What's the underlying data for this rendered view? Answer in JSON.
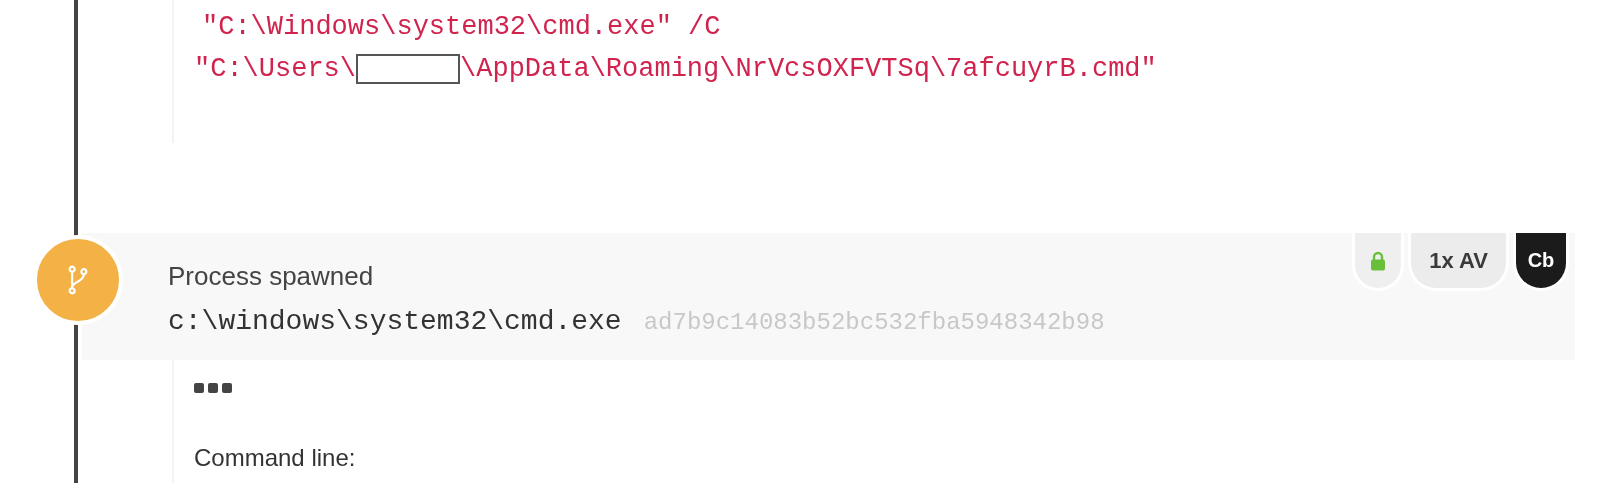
{
  "previous_event": {
    "command_line": {
      "line_1": "\"C:\\Windows\\system32\\cmd.exe\" /C",
      "line_2_start": "\"C:\\Users\\",
      "line_2_end": "\\AppData\\Roaming\\NrVcsOXFVTSq\\7afcuyrB.cmd\"",
      "redacted": true
    }
  },
  "event": {
    "title": "Process spawned",
    "path": "c:\\windows\\system32\\cmd.exe",
    "hash": "ad7b9c14083b52bc532fba5948342b98",
    "badges": [
      {
        "kind": "lock"
      },
      {
        "kind": "light",
        "label": "1x AV"
      },
      {
        "kind": "dark",
        "label": "Cb"
      }
    ],
    "body_label": "Command line:"
  }
}
